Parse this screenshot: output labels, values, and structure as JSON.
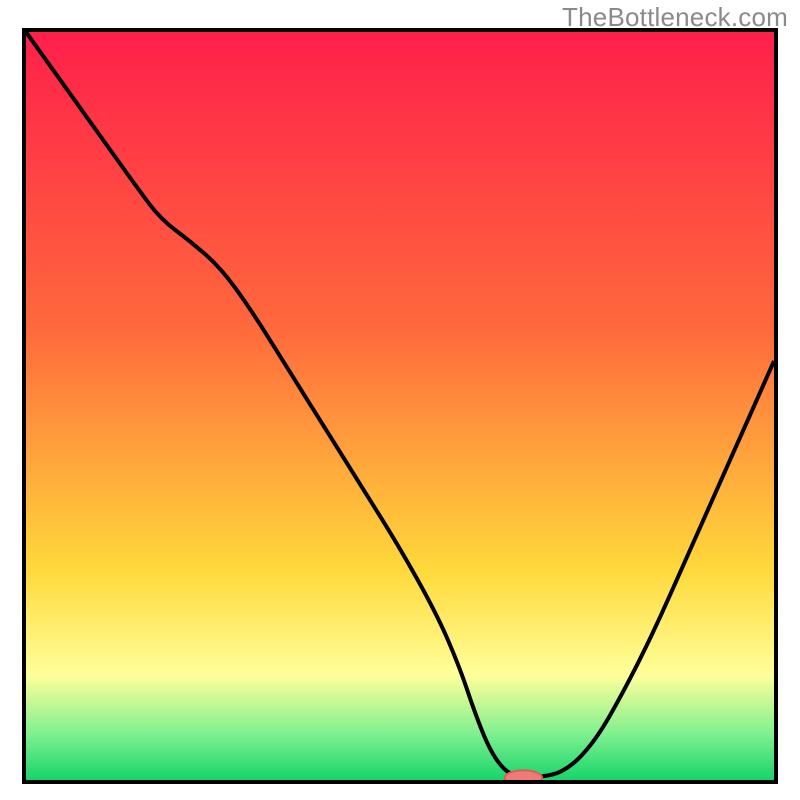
{
  "watermark": "TheBottleneck.com",
  "colors": {
    "border": "#000000",
    "curve": "#000000",
    "marker_fill": "#ef7a76",
    "marker_stroke": "#e05a55",
    "grad_top": "#ff1f4a",
    "grad_mid1": "#ff6a3c",
    "grad_mid2": "#ffd93b",
    "grad_band": "#ffff9a",
    "grad_green_top": "#7cf08f",
    "grad_green_bot": "#17d46b"
  },
  "chart_data": {
    "type": "line",
    "title": "",
    "xlabel": "",
    "ylabel": "",
    "xlim": [
      0,
      100
    ],
    "ylim": [
      0,
      100
    ],
    "x": [
      0,
      5,
      10,
      15,
      18,
      22,
      26,
      30,
      35,
      40,
      45,
      50,
      55,
      58,
      60,
      62,
      64,
      66,
      68,
      72,
      76,
      80,
      84,
      88,
      92,
      96,
      100
    ],
    "values": [
      100,
      93,
      86,
      79,
      75,
      72,
      68.5,
      63,
      55,
      47,
      39,
      31,
      22,
      15,
      9,
      4,
      1.2,
      0.3,
      0.3,
      1.0,
      5,
      12,
      20,
      29,
      38,
      47,
      56
    ],
    "marker": {
      "x": 66.5,
      "y": 0.3,
      "rx": 2.5,
      "ry": 1.0
    },
    "gradient_stops": [
      {
        "offset": 0.0,
        "key": "grad_top"
      },
      {
        "offset": 0.4,
        "key": "grad_mid1"
      },
      {
        "offset": 0.72,
        "key": "grad_mid2"
      },
      {
        "offset": 0.86,
        "key": "grad_band"
      },
      {
        "offset": 0.94,
        "key": "grad_green_top"
      },
      {
        "offset": 1.0,
        "key": "grad_green_bot"
      }
    ]
  }
}
